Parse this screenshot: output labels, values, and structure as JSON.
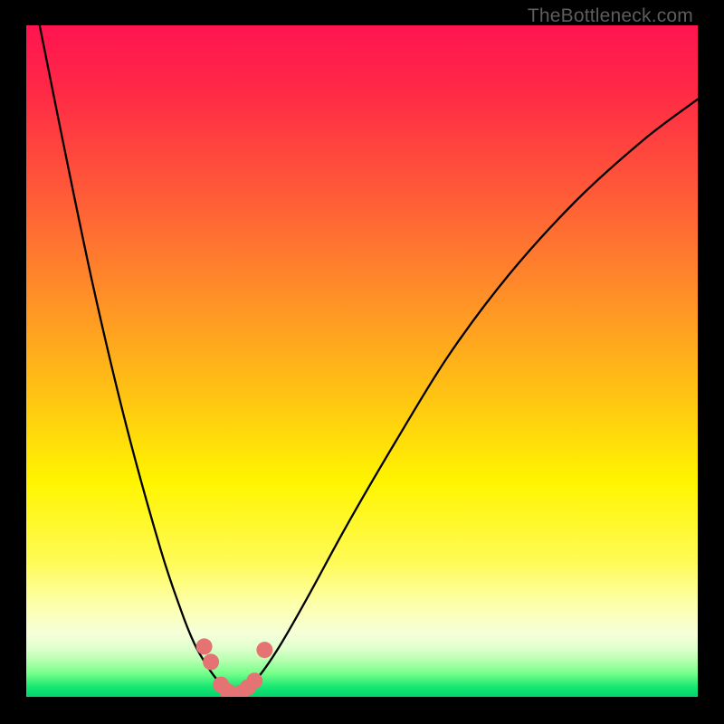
{
  "watermark": {
    "text": "TheBottleneck.com"
  },
  "chart_data": {
    "type": "line",
    "title": "",
    "xlabel": "",
    "ylabel": "",
    "xlim": [
      0,
      100
    ],
    "ylim": [
      0,
      100
    ],
    "x_valley": 31,
    "series": [
      {
        "name": "bottleneck-curve",
        "x": [
          2,
          5,
          10,
          15,
          20,
          23,
          25,
          27,
          29,
          30,
          31,
          32,
          33,
          35,
          38,
          42,
          48,
          55,
          63,
          72,
          82,
          92,
          100
        ],
        "y": [
          100,
          85,
          61,
          40,
          22,
          13,
          8,
          4.5,
          1.8,
          0.8,
          0.2,
          0.6,
          1.4,
          3.5,
          8,
          15,
          26,
          38,
          51,
          63,
          74,
          83,
          89
        ]
      },
      {
        "name": "dot-markers",
        "x": [
          26.5,
          27.5,
          29,
          30,
          31,
          32,
          33,
          34,
          35.5
        ],
        "y": [
          7.5,
          5.2,
          1.8,
          0.8,
          0.3,
          0.6,
          1.4,
          2.4,
          7.0
        ]
      }
    ],
    "gradient_stops": [
      {
        "offset": 0.0,
        "color": "#ff1450"
      },
      {
        "offset": 0.1,
        "color": "#ff2a46"
      },
      {
        "offset": 0.25,
        "color": "#ff5a38"
      },
      {
        "offset": 0.4,
        "color": "#ff8e28"
      },
      {
        "offset": 0.55,
        "color": "#ffc313"
      },
      {
        "offset": 0.68,
        "color": "#fff500"
      },
      {
        "offset": 0.8,
        "color": "#fffb57"
      },
      {
        "offset": 0.86,
        "color": "#fdffa8"
      },
      {
        "offset": 0.905,
        "color": "#f6ffd8"
      },
      {
        "offset": 0.925,
        "color": "#e3ffd0"
      },
      {
        "offset": 0.945,
        "color": "#b8ffb0"
      },
      {
        "offset": 0.965,
        "color": "#76ff8a"
      },
      {
        "offset": 0.985,
        "color": "#17e873"
      },
      {
        "offset": 1.0,
        "color": "#03d36a"
      }
    ]
  }
}
